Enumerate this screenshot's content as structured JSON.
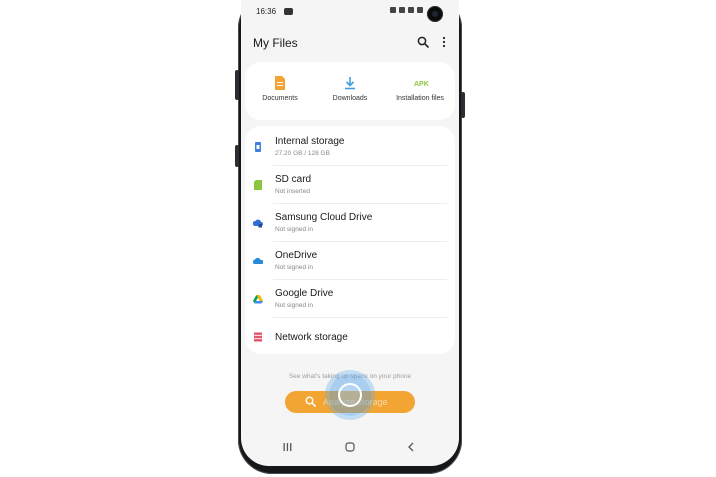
{
  "status": {
    "time": "16:36"
  },
  "appbar": {
    "title": "My Files",
    "search_icon": "search-icon",
    "more_icon": "more-vert-icon"
  },
  "categories": [
    {
      "label": "Documents",
      "icon": "document-icon",
      "color": "#f3a534"
    },
    {
      "label": "Downloads",
      "icon": "download-icon",
      "color": "#3f9de0"
    },
    {
      "label": "Installation files",
      "icon": "apk-icon",
      "icon_text": "APK",
      "color": "#8cc63f"
    }
  ],
  "storage": [
    {
      "name": "Internal storage",
      "sub": "27.20 GB / 128 GB",
      "icon": "phone-storage-icon",
      "color": "#3f7fe0"
    },
    {
      "name": "SD card",
      "sub": "Not inserted",
      "icon": "sd-card-icon",
      "color": "#8cc63f"
    },
    {
      "name": "Samsung Cloud Drive",
      "sub": "Not signed in",
      "icon": "samsung-cloud-icon",
      "color": "#2f6fd6"
    },
    {
      "name": "OneDrive",
      "sub": "Not signed in",
      "icon": "onedrive-icon",
      "color": "#2a8ad8"
    },
    {
      "name": "Google Drive",
      "sub": "Not signed in",
      "icon": "google-drive-icon",
      "color": "#f4b400"
    },
    {
      "name": "Network storage",
      "sub": "",
      "icon": "network-storage-icon",
      "color": "#e0566b"
    }
  ],
  "hint": "See what's taking up space on your phone",
  "analyze_button": {
    "label": "Analyze storage",
    "color": "#f3a534"
  },
  "nav": {
    "recents_icon": "recents-icon",
    "home_icon": "home-icon",
    "back_icon": "back-icon"
  }
}
